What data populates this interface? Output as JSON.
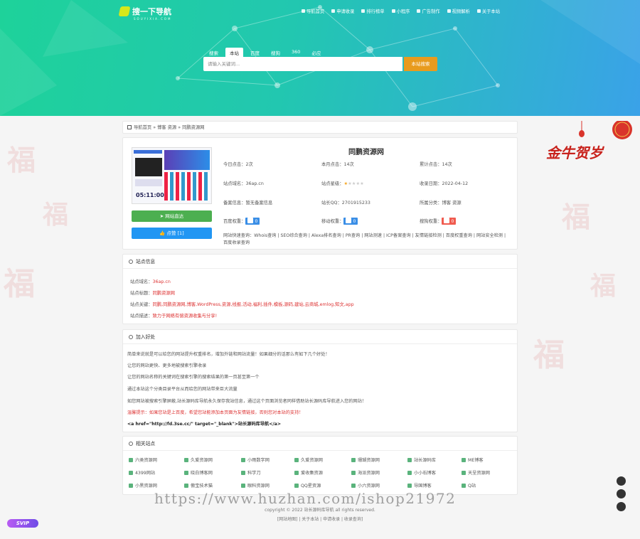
{
  "logo": {
    "title": "搜一下导航",
    "subtitle": "SOUYIXIA.COM"
  },
  "topnav": [
    "导航首页",
    "申请收录",
    "排行榜单",
    "小程序",
    "广告制作",
    "视频解析",
    "关于本站"
  ],
  "search": {
    "tabs": [
      "搜索",
      "本站",
      "百度",
      "搜狗",
      "360",
      "必应"
    ],
    "active_tab": "本站",
    "placeholder": "请输入关键词...",
    "button": "本站搜索"
  },
  "breadcrumb": "导航首页 » 博客 资源 » 同鹏资源网",
  "site": {
    "name": "同鹏资源网",
    "shot_clock": "05:11:00",
    "visit_button": "网站直达",
    "like_button": "点赞 [1]",
    "fields": {
      "today_clicks": "今日点击：2次",
      "month_clicks": "本月点击：14次",
      "total_clicks": "累计点击：14次",
      "domain": "站点域名：36ap.cn",
      "rating_label": "站点星级：",
      "rating": 1,
      "rating_max": 5,
      "added": "收录日期：2022-04-12",
      "icp": "备案信息：暂无备案信息",
      "qq": "站长QQ：2701915233",
      "category_label": "所属分类：",
      "category": "博客 资源",
      "baidu_label": "百度权重：",
      "baidu_value": "0",
      "mobile_label": "移动权重：",
      "mobile_value": "0",
      "sogou_label": "搜狗权重：",
      "sogou_value": "0"
    },
    "quick_links": "网站快速查询：Whois查询 | SEO综合查询 | Alexa排名查询 | PR查询 | 网站测速 | ICP备案查询 | 友情链接检测 | 百度权重查询 | 网站安全检测 | 百度收录查询"
  },
  "site_info": {
    "heading": "站点信息",
    "rows": [
      {
        "label": "站点域名：",
        "value": "36ap.cn"
      },
      {
        "label": "站点标题：",
        "value": "同鹏资源网"
      },
      {
        "label": "站点关键：",
        "value": "同鹏,同鹏资源网,博客,WordPress,资源,线报,活动,福利,插件,模板,源码,建站,云商城,emlog,知文,app"
      },
      {
        "label": "站点描述：",
        "value": "致力于网络有偿资源收集与分享!"
      }
    ]
  },
  "join": {
    "heading": "加入好处",
    "lines": [
      "简单来说就是可以给您的网站提升权重排名，增加外链和网站流量！如果细分的话那么有如下几个好处！",
      "让您的网站更快、更多地被搜索引擎收录",
      "让您的网站名称的关键词在搜索引擎的搜索结果的第一页甚至第一个",
      "通过本站这个分类目录平台从而给您的网站带来巨大流量",
      "如您网站被搜索引擎屏蔽,站长源码库导航永久保存我站信息，通过这个页面浏览者同样借助站长源码库导航进入您的网站！",
      "温馨提示：如果您站是上百度，希望您站能添加本页面为友情链接，否则您对本站的支持！",
      "<a href=\"http://fd.3se.cc/\" target=\"_blank\">站长源码库导航</a>"
    ]
  },
  "related": {
    "heading": "相关站点",
    "items": [
      "六类资源网",
      "久爱资源网",
      "小雨数字网",
      "久爱资源网",
      "珊瑚资源网",
      "站长源码库",
      "ME博客",
      "4399网站",
      "晓白博客网",
      "科学刀",
      "爱收集资源",
      "海派资源网",
      "小小石博客",
      "天呈资源网",
      "小黑资源网",
      "傲宝技术猫",
      "眼科资源网",
      "QQ星资源",
      "小六资源网",
      "导国博客",
      "Q站"
    ]
  },
  "footer": {
    "copyright": "copyright © 2022 站长源码库导航 all rights reserved.",
    "links": "[网站地图] | 关于本站 | 申请收录 | 收录查询]"
  },
  "watermark": "https://www.huzhan.com/ishop21972",
  "vip_badge": "SVIP",
  "deco_text": "金牛贺岁"
}
